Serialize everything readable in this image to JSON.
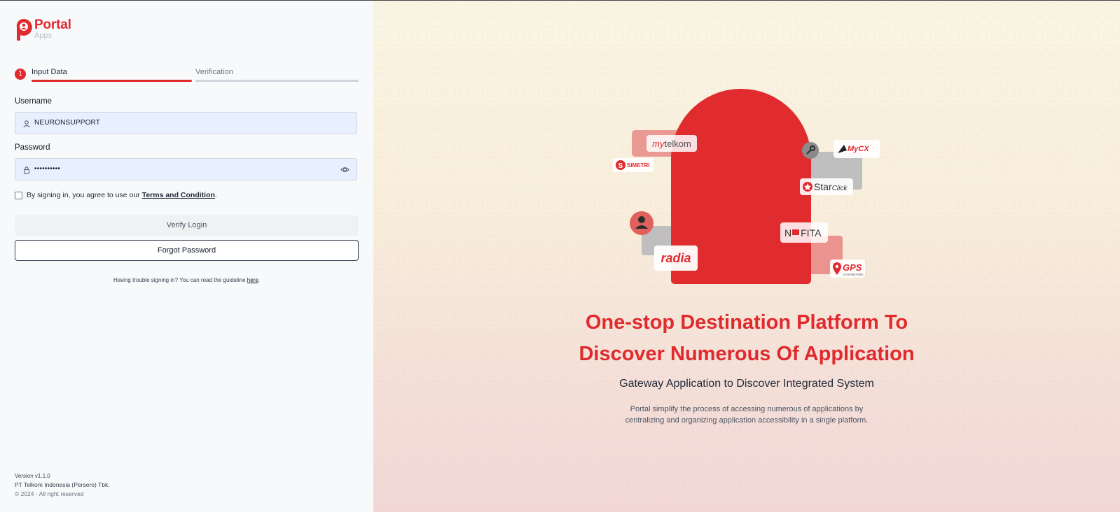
{
  "brand": {
    "name": "Portal",
    "sub": "Apps"
  },
  "steps": [
    {
      "number": "1",
      "label": "Input Data"
    },
    {
      "label": "Verification"
    }
  ],
  "form": {
    "username_label": "Username",
    "username_value": "NEURONSUPPORT",
    "password_label": "Password",
    "password_value": "••••••••••",
    "agree_text": "By signing in, you agree to use our",
    "agree_link": "Terms and Condition",
    "agree_end": ".",
    "verify_button": "Verify Login",
    "forgot_button": "Forgot Password",
    "trouble_text": "Having trouble signing in? You can read the guideline",
    "trouble_link": "here",
    "trouble_end": "."
  },
  "footer": {
    "version": "Version v1.1.0",
    "company": "PT Telkom Indonesia (Persero) Tbk.",
    "copyright": "© 2024 - All right reserved"
  },
  "hero": {
    "headline_line1": "One-stop Destination Platform To",
    "headline_line2": "Discover Numerous Of Application",
    "subheadline": "Gateway Application to Discover Integrated System",
    "description_line1": "Portal simplify the process of accessing numerous of applications by",
    "description_line2": "centralizing and organizing application accessibility in a single platform."
  },
  "app_logos": {
    "mytelkom_prefix": "my",
    "mytelkom_suffix": "telkom",
    "simetri": "SIMETRI",
    "mycx": "MyCX",
    "starclick_prefix": "Star",
    "starclick_suffix": "Click",
    "nafita_prefix": "N",
    "nafita_suffix": "FITA",
    "radia": "radia",
    "gps": "GPS",
    "gps_sub": "DASHBOARD"
  },
  "colors": {
    "accent": "#e02a2e",
    "field_bg": "#e8f0fe",
    "left_bg": "#f8f9fa"
  }
}
